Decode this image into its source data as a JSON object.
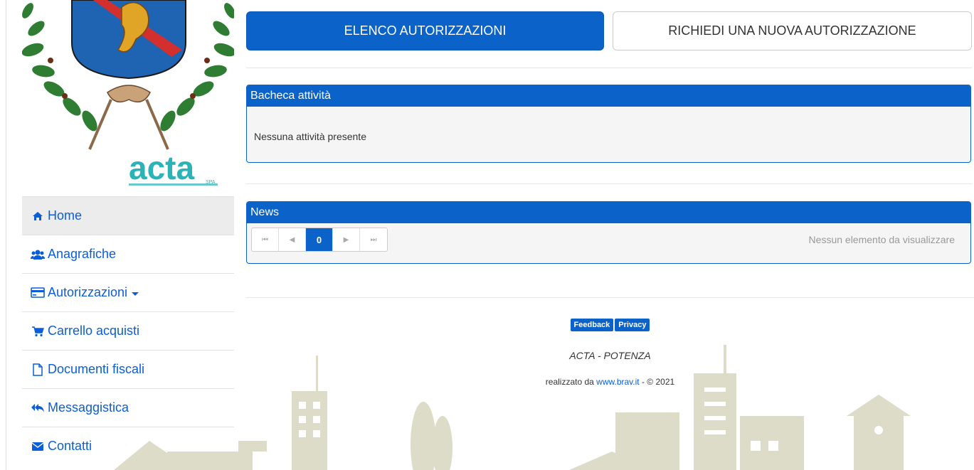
{
  "brand": {
    "logo_text": "acta",
    "logo_suffix": "SPA"
  },
  "sidebar": {
    "items": [
      {
        "label": "Home",
        "icon": "home-icon"
      },
      {
        "label": "Anagrafiche",
        "icon": "users-icon"
      },
      {
        "label": "Autorizzazioni",
        "icon": "credit-card-icon"
      },
      {
        "label": "Carrello acquisti",
        "icon": "cart-icon"
      },
      {
        "label": "Documenti fiscali",
        "icon": "document-icon"
      },
      {
        "label": "Messaggistica",
        "icon": "reply-all-icon"
      },
      {
        "label": "Contatti",
        "icon": "envelope-icon"
      }
    ]
  },
  "actions": {
    "list_label": "ELENCO AUTORIZZAZIONI",
    "new_label": "RICHIEDI UNA NUOVA AUTORIZZAZIONE"
  },
  "activity": {
    "title": "Bacheca attività",
    "empty": "Nessuna attività presente"
  },
  "news": {
    "title": "News",
    "page": "0",
    "empty": "Nessun elemento da visualizzare",
    "pager_first": "⏮",
    "pager_prev": "◀",
    "pager_next": "▶",
    "pager_last": "⏭"
  },
  "footer": {
    "feedback_label": "Feedback",
    "privacy_label": "Privacy",
    "org": "ACTA - POTENZA",
    "made_by_prefix": "realizzato da ",
    "made_by_link": "www.brav.it",
    "made_by_suffix": " - © 2021"
  },
  "colors": {
    "primary": "#0b63c9",
    "link": "#0b5ed7",
    "skyline": "#dcdcc9"
  }
}
